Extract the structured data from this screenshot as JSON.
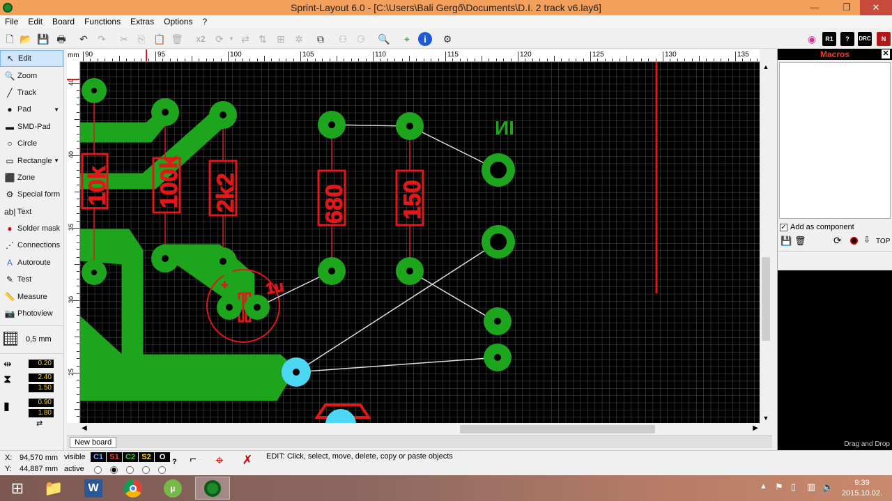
{
  "window": {
    "title": "Sprint-Layout 6.0 - [C:\\Users\\Bali Gergő\\Documents\\D.I. 2 track v6.lay6]",
    "minimize": "—",
    "restore": "❐",
    "close": "✕"
  },
  "menu": [
    "File",
    "Edit",
    "Board",
    "Functions",
    "Extras",
    "Options",
    "?"
  ],
  "toolbar": {
    "x2_label": "x2",
    "right_badges": [
      "R1",
      "DRC"
    ]
  },
  "tools": [
    {
      "label": "Edit",
      "icon": "arrow-icon",
      "glyph": "↖",
      "active": true
    },
    {
      "label": "Zoom",
      "icon": "magnifier-icon",
      "glyph": "🔍"
    },
    {
      "label": "Track",
      "icon": "track-icon",
      "glyph": "╱"
    },
    {
      "label": "Pad",
      "icon": "pad-icon",
      "glyph": "●",
      "dropdown": true
    },
    {
      "label": "SMD-Pad",
      "icon": "smd-pad-icon",
      "glyph": "▬"
    },
    {
      "label": "Circle",
      "icon": "circle-icon",
      "glyph": "○"
    },
    {
      "label": "Rectangle",
      "icon": "rectangle-icon",
      "glyph": "▭",
      "dropdown": true
    },
    {
      "label": "Zone",
      "icon": "zone-icon",
      "glyph": "⬛"
    },
    {
      "label": "Special form",
      "icon": "special-form-icon",
      "glyph": "⚙"
    },
    {
      "label": "Text",
      "icon": "text-icon",
      "glyph": "ab|"
    },
    {
      "label": "Solder mask",
      "icon": "solder-mask-icon",
      "glyph": "●"
    },
    {
      "label": "Connections",
      "icon": "connections-icon",
      "glyph": "⋰"
    },
    {
      "label": "Autoroute",
      "icon": "autoroute-icon",
      "glyph": "A"
    },
    {
      "label": "Test",
      "icon": "test-icon",
      "glyph": "✎"
    },
    {
      "label": "Measure",
      "icon": "measure-icon",
      "glyph": "📏"
    },
    {
      "label": "Photoview",
      "icon": "photoview-icon",
      "glyph": "📷"
    }
  ],
  "grid": {
    "label": "0,5 mm"
  },
  "params": {
    "track_width": "0.20",
    "pad_outer": "2.40",
    "pad_inner": "1.50",
    "smd_width": "0.90",
    "smd_height": "1.80"
  },
  "ruler": {
    "unit": "mm",
    "x_ticks": [
      "90",
      "95",
      "100",
      "105",
      "110",
      "115",
      "120",
      "125",
      "130",
      "135"
    ],
    "y_ticks": [
      "40",
      "40",
      "35",
      "30",
      "25"
    ]
  },
  "board": {
    "component_labels": [
      "10k",
      "100k",
      "2k2",
      "680",
      "150"
    ],
    "silk_text": "ИI",
    "cap_label": "1u",
    "cap_plus": "+"
  },
  "tabs": [
    "New board"
  ],
  "macros": {
    "title": "Macros",
    "add_component_label": "Add as component",
    "add_component_checked": true,
    "top_label": "TOP",
    "footer": "Drag and Drop"
  },
  "status": {
    "x_label": "X:",
    "x_value": "94,570 mm",
    "y_label": "Y:",
    "y_value": "44,887 mm",
    "visible_label": "visible",
    "active_label": "active",
    "layers": [
      "C1",
      "S1",
      "C2",
      "S2",
      "O"
    ],
    "help_mark": "?",
    "message": "EDIT:  Click, select, move, delete, copy or paste objects"
  },
  "taskbar": {
    "time": "9:39",
    "date": "2015.10.02."
  },
  "colors": {
    "copper": "#1ea51e",
    "silk": "#e01818",
    "pad_selected": "#4dd7f5",
    "title_bar": "#f2a05c",
    "board_bg": "#000000"
  }
}
